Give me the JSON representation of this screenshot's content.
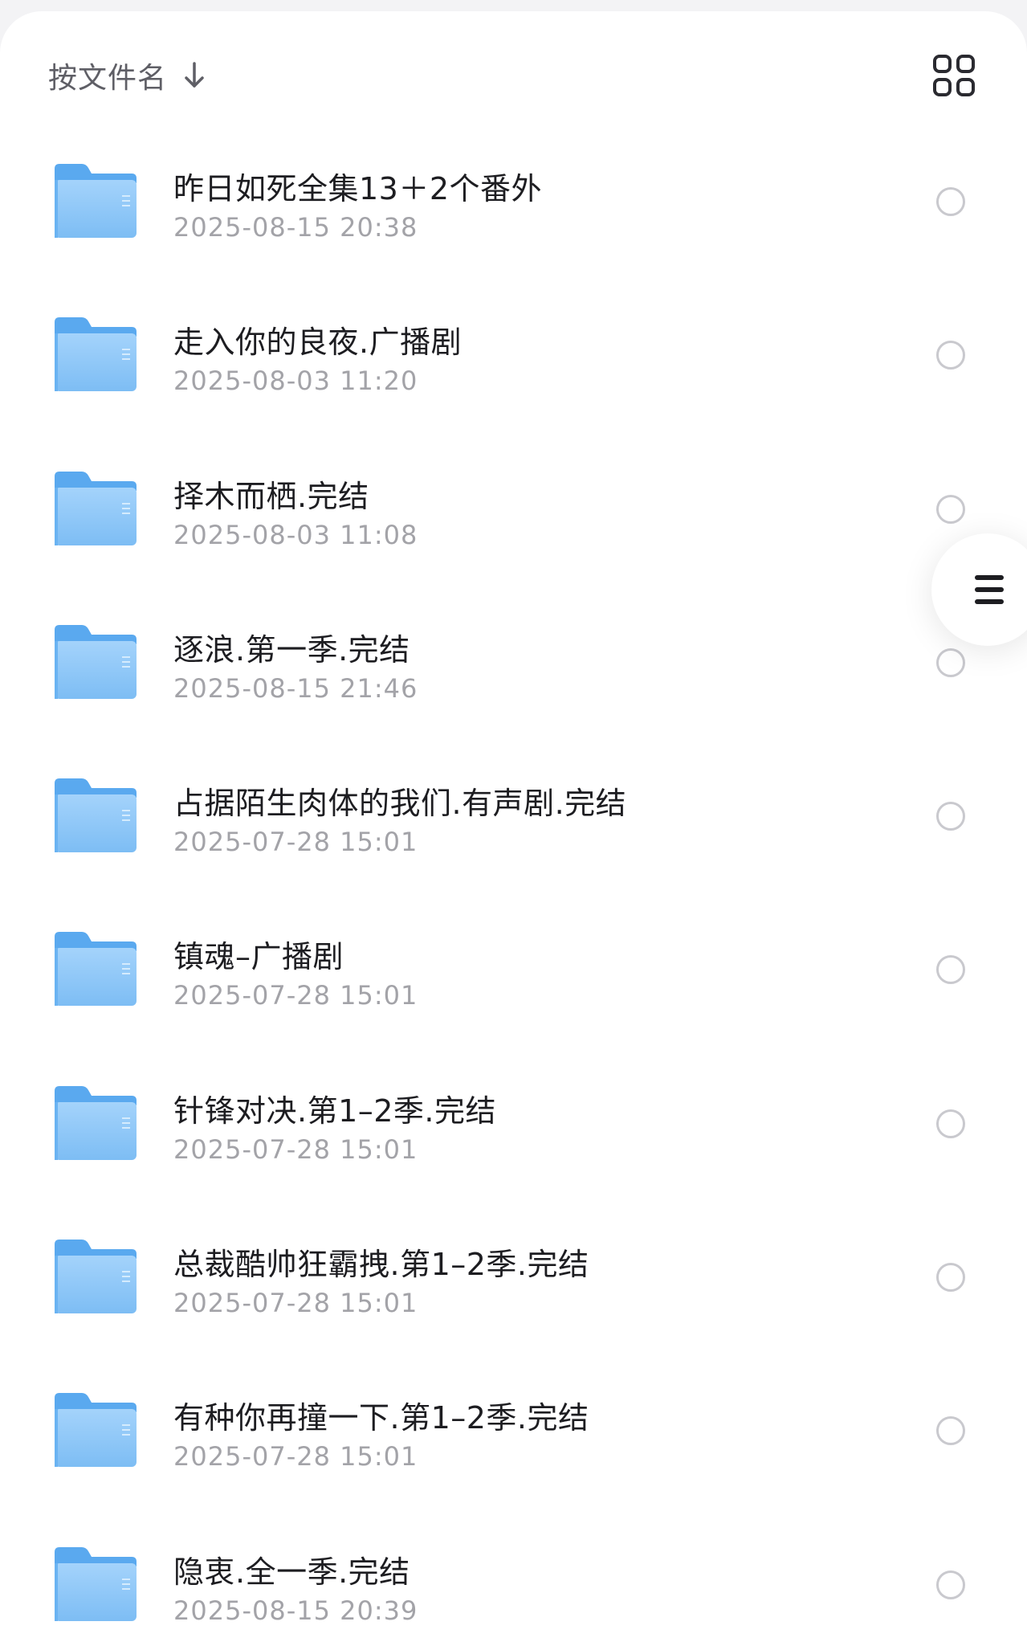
{
  "toolbar": {
    "sort_label": "按文件名",
    "sort_icon": "arrow-down-icon",
    "view_icon": "grid-view-icon"
  },
  "colors": {
    "folder": "#7cc0f7",
    "folder_light": "#a9d6fb",
    "radio_border": "#c9c9ce",
    "title_text": "#1d1d21",
    "date_text": "#a3a3a8"
  },
  "files": [
    {
      "name": "昨日如死全集13＋2个番外",
      "date": "2025-08-15 20:38"
    },
    {
      "name": "走入你的良夜.广播剧",
      "date": "2025-08-03 11:20"
    },
    {
      "name": "择木而栖.完结",
      "date": "2025-08-03 11:08"
    },
    {
      "name": "逐浪.第一季.完结",
      "date": "2025-08-15 21:46"
    },
    {
      "name": "占据陌生肉体的我们.有声剧.完结",
      "date": "2025-07-28 15:01"
    },
    {
      "name": "镇魂–广播剧",
      "date": "2025-07-28 15:01"
    },
    {
      "name": "针锋对决.第1–2季.完结",
      "date": "2025-07-28 15:01"
    },
    {
      "name": "总裁酷帅狂霸拽.第1–2季.完结",
      "date": "2025-07-28 15:01"
    },
    {
      "name": "有种你再撞一下.第1–2季.完结",
      "date": "2025-07-28 15:01"
    },
    {
      "name": "隐衷.全一季.完结",
      "date": "2025-08-15 20:39"
    }
  ],
  "floating_menu": {
    "icon": "menu-icon"
  }
}
